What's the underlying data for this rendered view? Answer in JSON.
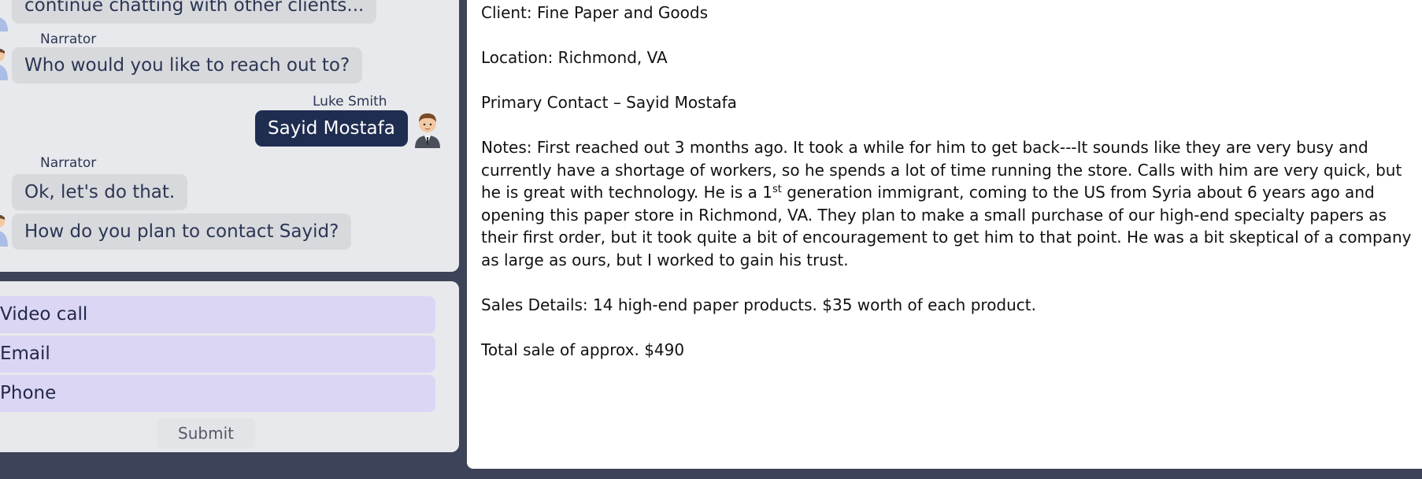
{
  "chat": {
    "messages": [
      {
        "speaker": "",
        "text": "continue chatting with other clients..."
      },
      {
        "speaker": "Narrator",
        "text": "Who would you like to reach out to?"
      },
      {
        "speaker": "Luke Smith",
        "text": "Sayid Mostafa"
      },
      {
        "speaker": "Narrator",
        "text": "Ok, let's do that."
      },
      {
        "speaker": "",
        "text": "How do you plan to contact Sayid?"
      }
    ]
  },
  "options": {
    "items": [
      {
        "label": "Video call"
      },
      {
        "label": "Email"
      },
      {
        "label": "Phone"
      }
    ],
    "submit_label": "Submit"
  },
  "document": {
    "client": "Client: Fine Paper and Goods",
    "location": "Location: Richmond, VA",
    "contact": "Primary Contact – Sayid Mostafa",
    "notes_before": "Notes: First reached out 3 months ago. It took a while for him to get back---It sounds like they are very busy and currently have a shortage of workers, so he spends a lot of time running the store. Calls with him are very quick, but he is great with technology. He is a 1",
    "notes_sup": "st",
    "notes_after": " generation immigrant, coming to the US from Syria about 6 years ago and opening this paper store in Richmond, VA. They plan to make a small purchase of our high-end specialty papers as their first order, but it took quite a bit of encouragement to get him to that point. He was a bit skeptical of a company as large as ours, but I worked to gain his trust.",
    "sales_details": "Sales Details: 14 high-end paper products. $35 worth of each product.",
    "total": "Total sale of approx. $490"
  },
  "colors": {
    "background": "#3d4459",
    "bot_bubble": "#d8d9dc",
    "user_bubble": "#1f2d50",
    "option_fill": "#dbd6f4"
  }
}
